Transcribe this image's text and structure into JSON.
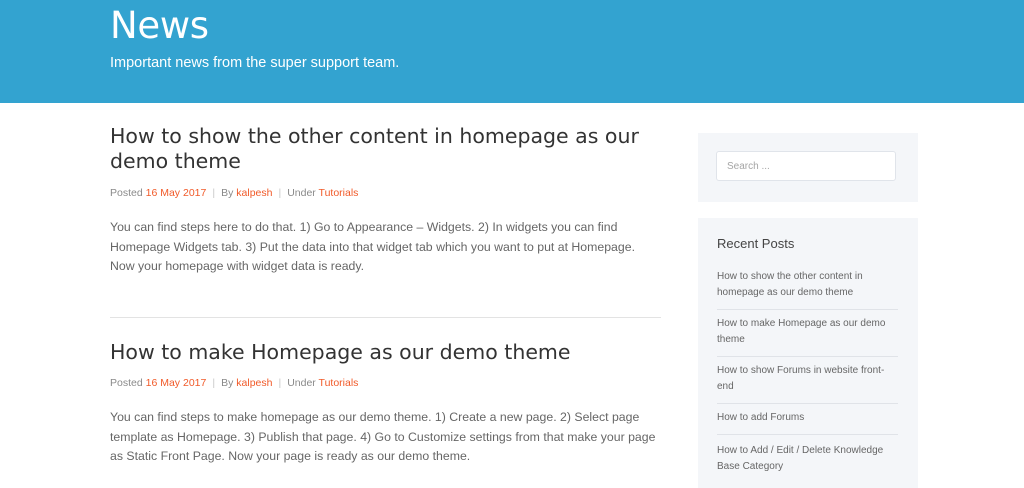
{
  "hero": {
    "title": "News",
    "subtitle": "Important news from the super support team."
  },
  "posts": [
    {
      "title": "How to show the other content in homepage as our demo theme",
      "posted_label": "Posted",
      "date": "16 May 2017",
      "by_label": "By",
      "author": "kalpesh",
      "under_label": "Under",
      "category": "Tutorials",
      "excerpt": "You can find steps here to do that. 1) Go to Appearance – Widgets. 2) In widgets you can find Homepage Widgets tab. 3) Put the data into that widget tab which you want to put at Homepage. Now your homepage with widget data is ready."
    },
    {
      "title": "How to make Homepage as our demo theme",
      "posted_label": "Posted",
      "date": "16 May 2017",
      "by_label": "By",
      "author": "kalpesh",
      "under_label": "Under",
      "category": "Tutorials",
      "excerpt": "You can find steps to make homepage as our demo theme. 1) Create a new page. 2) Select page template as Homepage. 3) Publish that page. 4) Go to Customize settings from that make your page as Static Front Page. Now your page is ready as our demo theme."
    }
  ],
  "sidebar": {
    "search_placeholder": "Search ...",
    "recent_title": "Recent Posts",
    "recent_posts": [
      "How to show the other content in homepage as our demo theme",
      "How to make Homepage as our demo theme",
      "How to show Forums in website front-end",
      "How to add Forums",
      "How to Add / Edit / Delete Knowledge Base Category"
    ]
  },
  "colors": {
    "header_bg": "#33a3d0",
    "accent": "#f15a29",
    "sidebar_bg": "#f4f6f9"
  }
}
